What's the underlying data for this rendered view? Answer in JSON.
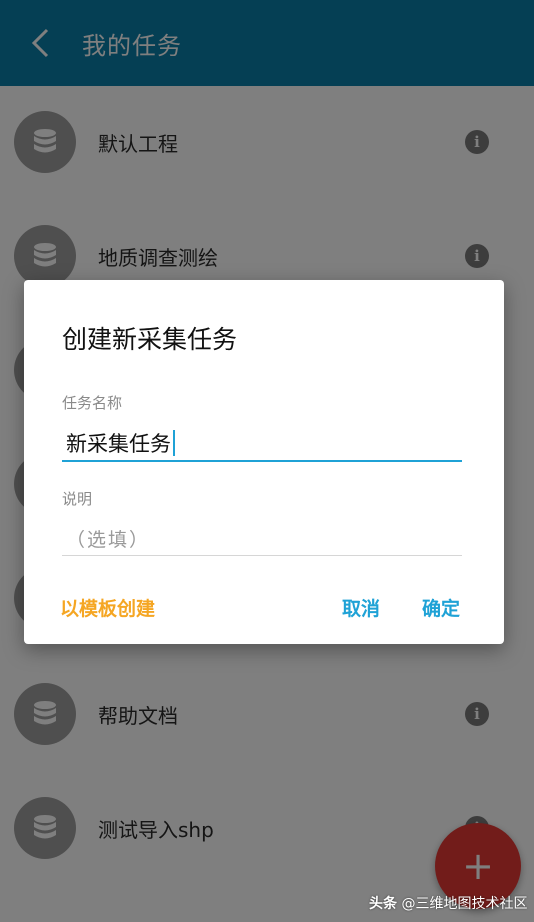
{
  "appbar": {
    "title": "我的任务",
    "icon": "chevron-left-icon",
    "color": "#0b7fa8"
  },
  "tasks": [
    {
      "name": "默认工程"
    },
    {
      "name": "地质调查测绘"
    },
    {
      "name": ""
    },
    {
      "name": ""
    },
    {
      "name": ""
    },
    {
      "name": "帮助文档"
    },
    {
      "name": "测试导入shp"
    }
  ],
  "dialog": {
    "title": "创建新采集任务",
    "name_label": "任务名称",
    "name_value": "新采集任务",
    "desc_label": "说明",
    "desc_placeholder": "（选填）",
    "template_button": "以模板创建",
    "cancel_button": "取消",
    "ok_button": "确定"
  },
  "fab": {
    "label": "+",
    "color": "#e53935"
  },
  "watermark": {
    "logo": "头条",
    "text": "@三维地图技术社区"
  }
}
